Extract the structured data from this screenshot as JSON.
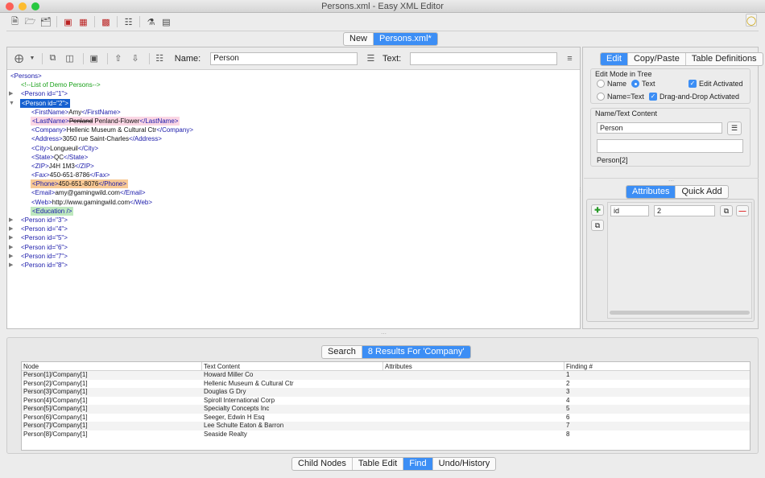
{
  "window": {
    "title": "Persons.xml - Easy XML Editor"
  },
  "toolbar": {
    "icons": [
      "new-file-icon",
      "open-folder-icon",
      "open-recent-icon",
      "save-icon",
      "save-all-icon",
      "export-icon",
      "tree-icon",
      "validate-icon",
      "document-icon"
    ],
    "bulb_icon": "lightbulb-icon"
  },
  "doc_tabs": [
    "New",
    "Persons.xml*"
  ],
  "edit_bar": {
    "name_label": "Name:",
    "name_value": "Person",
    "text_label": "Text:",
    "text_value": ""
  },
  "tree": {
    "root": "<Persons>",
    "comment": "<!--List of Demo Persons-->",
    "p1": "<Person id=\"1\">",
    "p2": "<Person id=\"2\">",
    "first": {
      "open": "<FirstName>",
      "val": "Amy",
      "close": "</FirstName>"
    },
    "last": {
      "open": "<LastName>",
      "old": "Penland",
      "val": " Penland-Flower",
      "close": "</LastName>"
    },
    "company": {
      "open": "<Company>",
      "val": "Hellenic Museum & Cultural Ctr",
      "close": "</Company>"
    },
    "address": {
      "open": "<Address>",
      "val": "3050 rue Saint-Charles",
      "close": "</Address>"
    },
    "city": {
      "open": "<City>",
      "val": "Longueuil",
      "close": "</City>"
    },
    "state": {
      "open": "<State>",
      "val": "QC",
      "close": "</State>"
    },
    "zip": {
      "open": "<ZIP>",
      "val": "J4H 1M3",
      "close": "</ZIP>"
    },
    "fax": {
      "open": "<Fax>",
      "val": "450-651-8786",
      "close": "</Fax>"
    },
    "phone": {
      "open": "<Phone>",
      "val": "450-651-8076",
      "close": "</Phone>"
    },
    "email": {
      "open": "<Email>",
      "val": "amy@gamingwild.com",
      "close": "</Email>"
    },
    "web": {
      "open": "<Web>",
      "val": "http://www.gamingwild.com",
      "close": "</Web>"
    },
    "education": "<Education />",
    "p3": "<Person id=\"3\">",
    "p4": "<Person id=\"4\">",
    "p5": "<Person id=\"5\">",
    "p6": "<Person id=\"6\">",
    "p7": "<Person id=\"7\">",
    "p8": "<Person id=\"8\">"
  },
  "right_panel": {
    "tabs": [
      "Edit",
      "Copy/Paste",
      "Table Definitions"
    ],
    "edit_mode": {
      "title": "Edit Mode in Tree",
      "name": "Name",
      "text": "Text",
      "name_text": "Name=Text",
      "edit_activated": "Edit Activated",
      "drag_drop": "Drag-and-Drop Activated"
    },
    "name_text_content": {
      "title": "Name/Text Content",
      "name_value": "Person",
      "text_value": "",
      "path": "Person[2]"
    },
    "attr_tabs": [
      "Attributes",
      "Quick Add"
    ],
    "attribute": {
      "name": "id",
      "value": "2"
    }
  },
  "find": {
    "tabs": [
      "Search",
      "8 Results For 'Company'"
    ],
    "columns": [
      "Node",
      "Text Content",
      "Attributes",
      "Finding #"
    ],
    "rows": [
      [
        "Person[1]/Company[1]",
        "Howard Miller Co",
        "",
        "1"
      ],
      [
        "Person[2]/Company[1]",
        "Hellenic Museum & Cultural Ctr",
        "",
        "2"
      ],
      [
        "Person[3]/Company[1]",
        "Douglas G Dry",
        "",
        "3"
      ],
      [
        "Person[4]/Company[1]",
        "Spiroll International Corp",
        "",
        "4"
      ],
      [
        "Person[5]/Company[1]",
        "Specialty Concepts Inc",
        "",
        "5"
      ],
      [
        "Person[6]/Company[1]",
        "Seeger, Edwin H Esq",
        "",
        "6"
      ],
      [
        "Person[7]/Company[1]",
        "Lee Schulte Eaton & Barron",
        "",
        "7"
      ],
      [
        "Person[8]/Company[1]",
        "Seaside Realty",
        "",
        "8"
      ]
    ]
  },
  "main_tabs": [
    "Child Nodes",
    "Table Edit",
    "Find",
    "Undo/History"
  ]
}
